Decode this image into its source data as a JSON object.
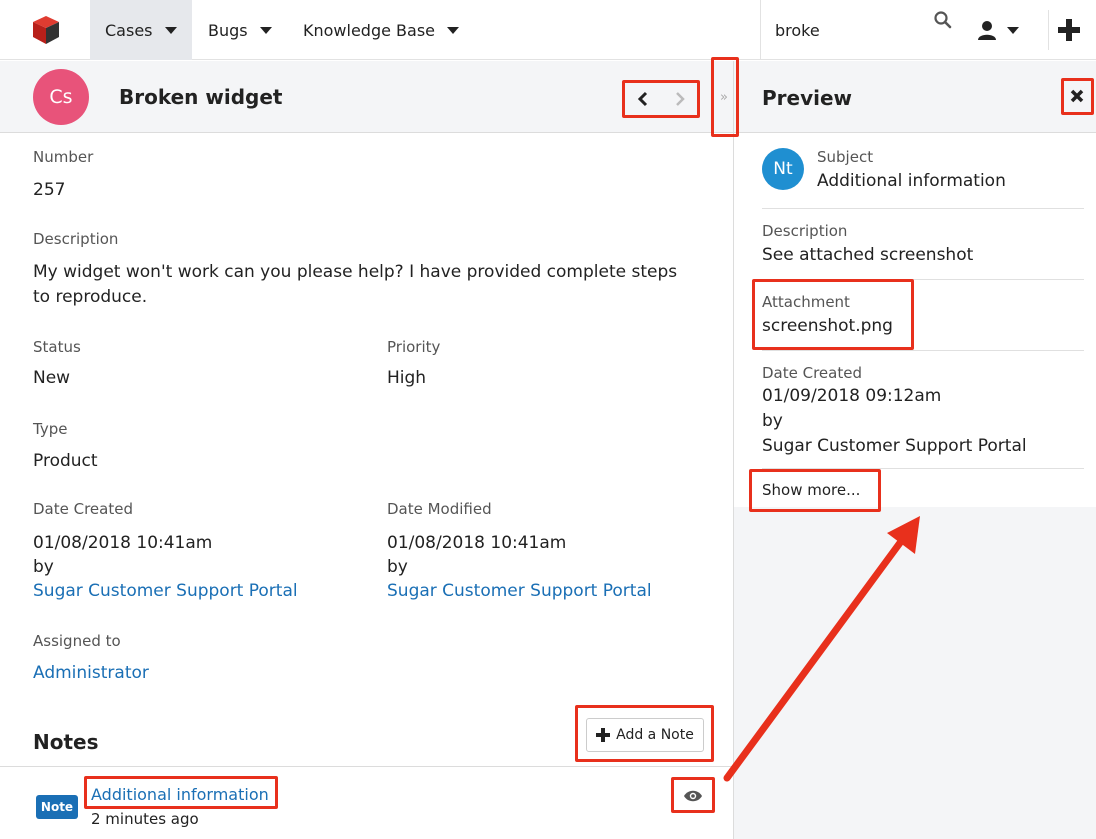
{
  "nav": {
    "tabs": [
      {
        "label": "Cases"
      },
      {
        "label": "Bugs"
      },
      {
        "label": "Knowledge Base"
      }
    ],
    "search_value": "broke"
  },
  "record": {
    "avatar_initials": "Cs",
    "avatar_color": "#e8537a",
    "title": "Broken widget",
    "number_label": "Number",
    "number": "257",
    "description_label": "Description",
    "description": "My widget won't work can you please help? I have provided complete steps to reproduce.",
    "status_label": "Status",
    "status": "New",
    "priority_label": "Priority",
    "priority": "High",
    "type_label": "Type",
    "type": "Product",
    "date_created_label": "Date Created",
    "date_created": "01/08/2018 10:41am",
    "created_by_prefix": "by",
    "created_by": "Sugar Customer Support Portal",
    "date_modified_label": "Date Modified",
    "date_modified": "01/08/2018 10:41am",
    "modified_by_prefix": "by",
    "modified_by": "Sugar Customer Support Portal",
    "assigned_label": "Assigned to",
    "assigned_to": "Administrator"
  },
  "notes": {
    "title": "Notes",
    "add_label": "Add a Note",
    "items": [
      {
        "badge": "Note",
        "subject": "Additional information",
        "time": "2 minutes ago"
      }
    ]
  },
  "preview": {
    "title": "Preview",
    "avatar_initials": "Nt",
    "avatar_color": "#1f8fd1",
    "subject_label": "Subject",
    "subject": "Additional information",
    "description_label": "Description",
    "description": "See attached screenshot",
    "attachment_label": "Attachment",
    "attachment": "screenshot.png",
    "date_created_label": "Date Created",
    "date_created": "01/09/2018 09:12am",
    "by_prefix": "by",
    "created_by": "Sugar Customer Support Portal",
    "show_more": "Show more..."
  },
  "colors": {
    "link": "#1a6fb5",
    "highlight": "#e8301c",
    "panel_bg": "#f4f5f7"
  }
}
